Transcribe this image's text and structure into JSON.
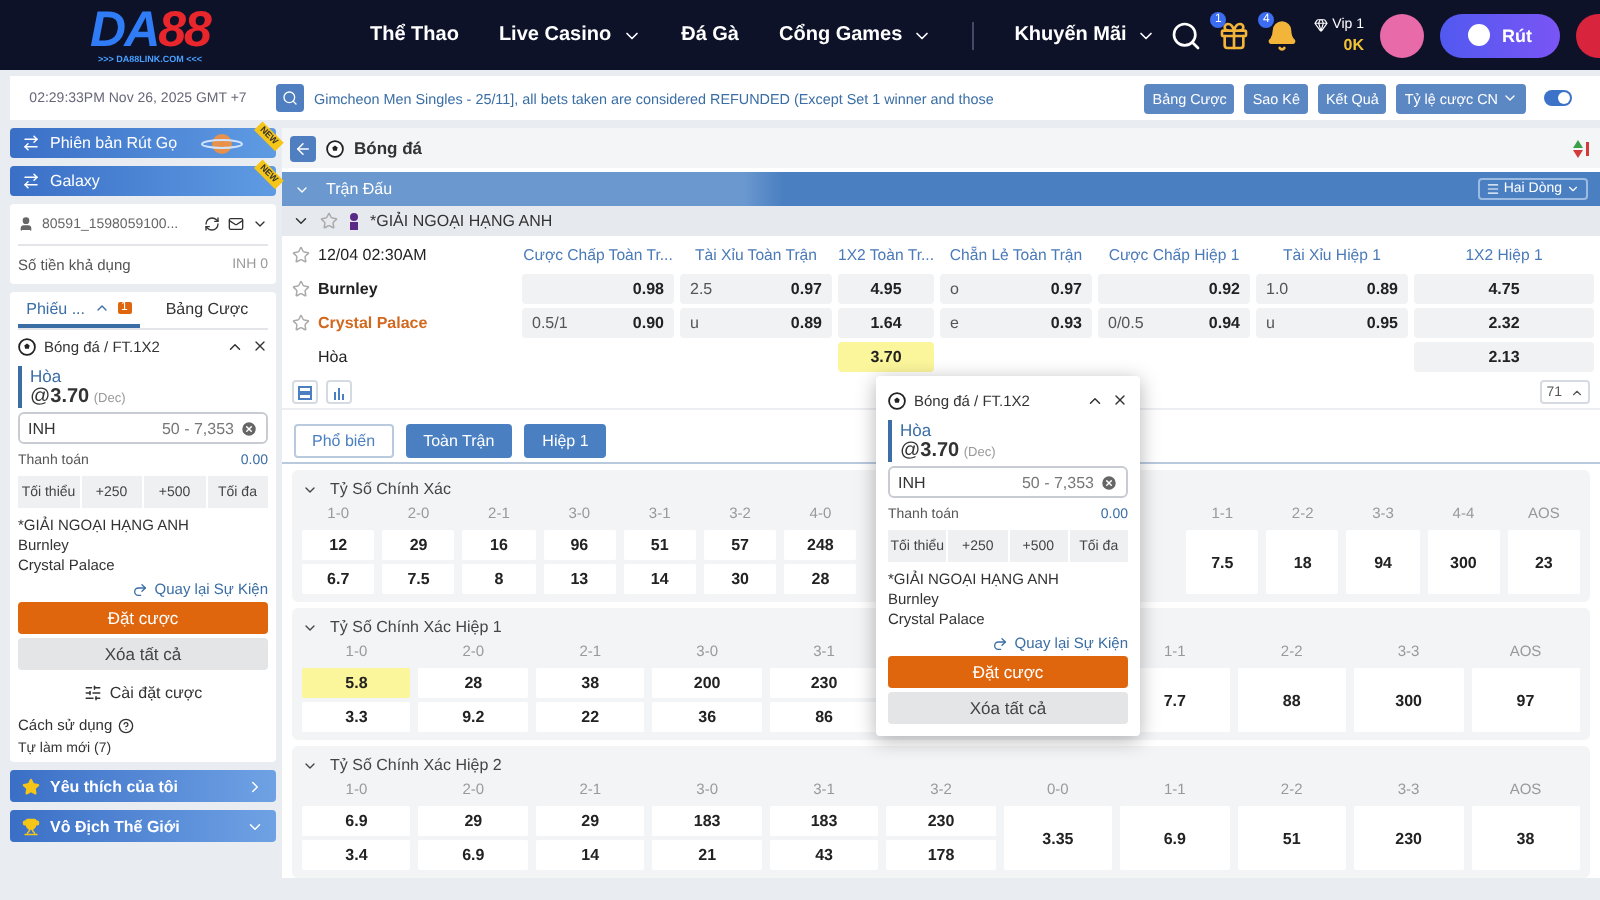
{
  "header": {
    "logo": {
      "part_1": "DA",
      "part_2": "88",
      "tagline": ">>> DA88LINK.COM <<<"
    },
    "nav": [
      {
        "label": "Thể Thao",
        "dropdown": false
      },
      {
        "label": "Live Casino",
        "dropdown": true
      },
      {
        "label": "Đá Gà",
        "dropdown": false
      },
      {
        "label": "Cổng Games",
        "dropdown": true
      },
      {
        "label": "Khuyến Mãi",
        "dropdown": true
      }
    ],
    "gift_badge": "1",
    "bell_badge": "4",
    "vip": {
      "level": "Vip 1",
      "balance": "0K"
    },
    "withdraw_button": "Rút"
  },
  "info_bar": {
    "clock": "02:29:33PM Nov 26, 2025 GMT +7",
    "ticker": "Gimcheon Men Singles - 25/11], all bets taken are considered REFUNDED (Except Set 1 winner and those",
    "buttons": [
      {
        "label": "Bảng Cược",
        "dropdown": false
      },
      {
        "label": "Sao Kê",
        "dropdown": false
      },
      {
        "label": "Kết Quả",
        "dropdown": false
      },
      {
        "label": "Tỷ lệ cược CN",
        "dropdown": true
      }
    ],
    "toggle": {
      "on": true
    }
  },
  "sidebar": {
    "banners": [
      {
        "label": "Phiên bản Rút Gọ",
        "ribbon": "NEW"
      },
      {
        "label": "Galaxy",
        "ribbon": "NEW"
      }
    ],
    "account": {
      "username": "80591_1598059100...",
      "balance_label": "Số tiền khả dụng",
      "balance": "INH 0"
    },
    "slip_tabs": [
      {
        "label": "Phiếu ...",
        "badge": "1",
        "selected": true
      },
      {
        "label": "Bảng Cược",
        "selected": false
      }
    ],
    "bet": {
      "market": "Bóng đá / FT.1X2",
      "selection": "Hòa",
      "odds": "@**3.70**",
      "odds_format": "(Dec)",
      "currency": "INH",
      "placeholder": "50 - 7,353",
      "payout_label": "Thanh toán",
      "payout": "0.00",
      "quick_stakes": [
        "Tối thiểu",
        "+250",
        "+500",
        "Tối đa"
      ],
      "league": "*GIẢI NGOẠI HẠNG ANH",
      "teams": [
        "Burnley",
        "Crystal Palace"
      ],
      "back_link": "Quay lại Sự Kiện",
      "place_button": "Đặt cược",
      "clear_button": "Xóa tất cả"
    },
    "settings": "Cài đặt cược",
    "help": "Cách sử dụng",
    "auto_refresh": "Tự làm mới (7)",
    "menu": [
      {
        "label": "Yêu thích của tôi",
        "kind": "favorites",
        "expanded": false
      },
      {
        "label": "Vô Địch Thế Giới",
        "kind": "competition",
        "expanded": true
      }
    ]
  },
  "main": {
    "sport": "Bóng đá",
    "section": "Trận Đấu",
    "view_button": "Hai Dòng",
    "league": "*GIẢI NGOẠI HẠNG ANH",
    "league_expanded": true,
    "match": {
      "time": "12/04 02:30AM",
      "rows": [
        {
          "label": "Burnley",
          "kind": "team",
          "favorite": false
        },
        {
          "label": "Crystal Palace",
          "kind": "team",
          "favorite": true
        },
        {
          "label": "Hòa",
          "kind": "draw",
          "favorite": false
        }
      ],
      "markets": [
        {
          "title": "Cược Chấp Toàn Tr...",
          "cells": [
            {
              "odds": "0.98",
              "selected": false
            },
            {
              "line": "0.5/1",
              "odds": "0.90",
              "selected": false
            },
            null
          ]
        },
        {
          "title": "Tài Xỉu Toàn Trận",
          "cells": [
            {
              "line": "2.5",
              "odds": "0.97",
              "selected": false
            },
            {
              "line": "u",
              "odds": "0.89",
              "selected": false
            },
            null
          ]
        },
        {
          "title": "1X2 Toàn Tr...",
          "cells": [
            {
              "odds": "4.95",
              "selected": false
            },
            {
              "odds": "1.64",
              "selected": false
            },
            {
              "odds": "3.70",
              "selected": true
            }
          ]
        },
        {
          "title": "Chẵn Lẻ Toàn Trận",
          "cells": [
            {
              "line": "o",
              "odds": "0.97",
              "selected": false
            },
            {
              "line": "e",
              "odds": "0.93",
              "selected": false
            },
            null
          ]
        },
        {
          "title": "Cược Chấp Hiệp 1",
          "cells": [
            {
              "odds": "0.92",
              "selected": false
            },
            {
              "line": "0/0.5",
              "odds": "0.94",
              "selected": false
            },
            null
          ]
        },
        {
          "title": "Tài Xỉu Hiệp 1",
          "cells": [
            {
              "line": "1.0",
              "odds": "0.89",
              "selected": false
            },
            {
              "line": "u",
              "odds": "0.95",
              "selected": false
            },
            null
          ]
        },
        {
          "title": "1X2 Hiệp 1",
          "cells": [
            {
              "odds": "4.75",
              "selected": false
            },
            {
              "odds": "2.32",
              "selected": false
            },
            {
              "odds": "2.13",
              "selected": false
            }
          ]
        }
      ]
    },
    "count": "71",
    "tabs": [
      {
        "label": "Phổ biến",
        "selected": true
      },
      {
        "label": "Toàn Trận",
        "selected": false
      },
      {
        "label": "Hiệp 1",
        "selected": false
      }
    ],
    "score_markets": [
      {
        "title": "Tỷ Số Chính Xác",
        "expanded": true,
        "left": [
          {
            "label": "1-0",
            "odds": [
              {
                "value": "12",
                "selected": false
              },
              {
                "value": "6.7",
                "selected": false
              }
            ]
          },
          {
            "label": "2-0",
            "odds": [
              {
                "value": "29",
                "selected": false
              },
              {
                "value": "7.5",
                "selected": false
              }
            ]
          },
          {
            "label": "2-1",
            "odds": [
              {
                "value": "16",
                "selected": false
              },
              {
                "value": "8",
                "selected": false
              }
            ]
          },
          {
            "label": "3-0",
            "odds": [
              {
                "value": "96",
                "selected": false
              },
              {
                "value": "13",
                "selected": false
              }
            ]
          },
          {
            "label": "3-1",
            "odds": [
              {
                "value": "51",
                "selected": false
              },
              {
                "value": "14",
                "selected": false
              }
            ]
          },
          {
            "label": "3-2",
            "odds": [
              {
                "value": "57",
                "selected": false
              },
              {
                "value": "30",
                "selected": false
              }
            ]
          },
          {
            "label": "4-0",
            "odds": [
              {
                "value": "248",
                "selected": false
              },
              {
                "value": "28",
                "selected": false
              }
            ]
          }
        ],
        "right": [
          {
            "label": "1-1",
            "odds": [
              {
                "value": "7.5",
                "selected": false
              }
            ]
          },
          {
            "label": "2-2",
            "odds": [
              {
                "value": "18",
                "selected": false
              }
            ]
          },
          {
            "label": "3-3",
            "odds": [
              {
                "value": "94",
                "selected": false
              }
            ]
          },
          {
            "label": "4-4",
            "odds": [
              {
                "value": "300",
                "selected": false
              }
            ]
          },
          {
            "label": "AOS",
            "odds": [
              {
                "value": "23",
                "selected": false
              }
            ]
          }
        ]
      },
      {
        "title": "Tỷ Số Chính Xác Hiệp 1",
        "expanded": true,
        "left": [
          {
            "label": "1-0",
            "odds": [
              {
                "value": "5.8",
                "selected": true
              },
              {
                "value": "3.3",
                "selected": false
              }
            ]
          },
          {
            "label": "2-0",
            "odds": [
              {
                "value": "28",
                "selected": false
              },
              {
                "value": "9.2",
                "selected": false
              }
            ]
          },
          {
            "label": "2-1",
            "odds": [
              {
                "value": "38",
                "selected": false
              },
              {
                "value": "22",
                "selected": false
              }
            ]
          },
          {
            "label": "3-0",
            "odds": [
              {
                "value": "200",
                "selected": false
              },
              {
                "value": "36",
                "selected": false
              }
            ]
          },
          {
            "label": "3-1",
            "odds": [
              {
                "value": "230",
                "selected": false
              },
              {
                "value": "86",
                "selected": false
              }
            ]
          }
        ],
        "right": [
          {
            "label": "1-1",
            "odds": [
              {
                "value": "7.7",
                "selected": false
              }
            ]
          },
          {
            "label": "2-2",
            "odds": [
              {
                "value": "88",
                "selected": false
              }
            ]
          },
          {
            "label": "3-3",
            "odds": [
              {
                "value": "300",
                "selected": false
              }
            ]
          },
          {
            "label": "AOS",
            "odds": [
              {
                "value": "97",
                "selected": false
              }
            ]
          }
        ]
      },
      {
        "title": "Tỷ Số Chính Xác Hiệp 2",
        "expanded": true,
        "left": [
          {
            "label": "1-0",
            "odds": [
              {
                "value": "6.9",
                "selected": false
              },
              {
                "value": "3.4",
                "selected": false
              }
            ]
          },
          {
            "label": "2-0",
            "odds": [
              {
                "value": "29",
                "selected": false
              },
              {
                "value": "6.9",
                "selected": false
              }
            ]
          },
          {
            "label": "2-1",
            "odds": [
              {
                "value": "29",
                "selected": false
              },
              {
                "value": "14",
                "selected": false
              }
            ]
          },
          {
            "label": "3-0",
            "odds": [
              {
                "value": "183",
                "selected": false
              },
              {
                "value": "21",
                "selected": false
              }
            ]
          },
          {
            "label": "3-1",
            "odds": [
              {
                "value": "183",
                "selected": false
              },
              {
                "value": "43",
                "selected": false
              }
            ]
          },
          {
            "label": "3-2",
            "odds": [
              {
                "value": "230",
                "selected": false
              },
              {
                "value": "178",
                "selected": false
              }
            ]
          }
        ],
        "right": [
          {
            "label": "0-0",
            "odds": [
              {
                "value": "3.35",
                "selected": false
              }
            ]
          },
          {
            "label": "1-1",
            "odds": [
              {
                "value": "6.9",
                "selected": false
              }
            ]
          },
          {
            "label": "2-2",
            "odds": [
              {
                "value": "51",
                "selected": false
              }
            ]
          },
          {
            "label": "3-3",
            "odds": [
              {
                "value": "230",
                "selected": false
              }
            ]
          },
          {
            "label": "AOS",
            "odds": [
              {
                "value": "38",
                "selected": false
              }
            ]
          }
        ]
      }
    ]
  },
  "popup": {
    "bet": {
      "market": "Bóng đá / FT.1X2",
      "selection": "Hòa",
      "odds": "@**3.70**",
      "odds_format": "(Dec)",
      "currency": "INH",
      "placeholder": "50 - 7,353",
      "payout_label": "Thanh toán",
      "payout": "0.00",
      "quick_stakes": [
        "Tối thiểu",
        "+250",
        "+500",
        "Tối đa"
      ],
      "league": "*GIẢI NGOẠI HẠNG ANH",
      "teams": [
        "Burnley",
        "Crystal Palace"
      ],
      "back_link": "Quay lại Sự Kiện",
      "place_button": "Đặt cược",
      "clear_button": "Xóa tất cả"
    }
  }
}
